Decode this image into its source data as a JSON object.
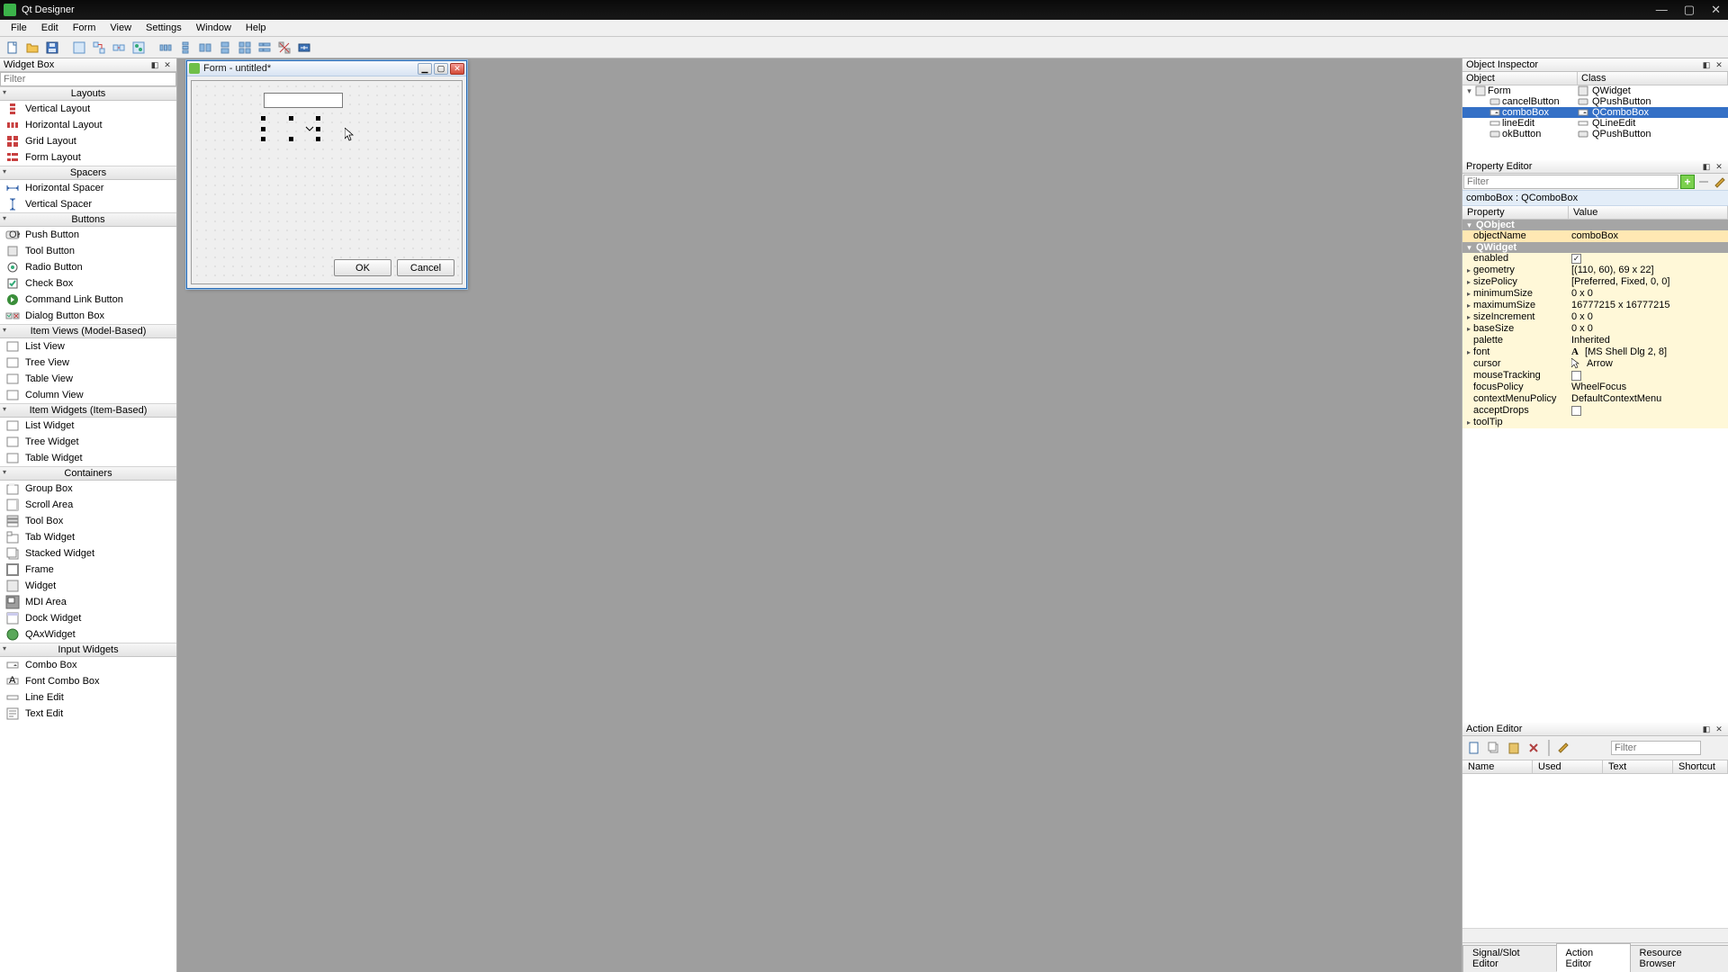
{
  "app": {
    "title": "Qt Designer"
  },
  "menu": [
    "File",
    "Edit",
    "Form",
    "View",
    "Settings",
    "Window",
    "Help"
  ],
  "widget_box": {
    "title": "Widget Box",
    "filter_ph": "Filter",
    "cats": [
      {
        "name": "Layouts",
        "items": [
          "Vertical Layout",
          "Horizontal Layout",
          "Grid Layout",
          "Form Layout"
        ]
      },
      {
        "name": "Spacers",
        "items": [
          "Horizontal Spacer",
          "Vertical Spacer"
        ]
      },
      {
        "name": "Buttons",
        "items": [
          "Push Button",
          "Tool Button",
          "Radio Button",
          "Check Box",
          "Command Link Button",
          "Dialog Button Box"
        ]
      },
      {
        "name": "Item Views (Model-Based)",
        "items": [
          "List View",
          "Tree View",
          "Table View",
          "Column View"
        ]
      },
      {
        "name": "Item Widgets (Item-Based)",
        "items": [
          "List Widget",
          "Tree Widget",
          "Table Widget"
        ]
      },
      {
        "name": "Containers",
        "items": [
          "Group Box",
          "Scroll Area",
          "Tool Box",
          "Tab Widget",
          "Stacked Widget",
          "Frame",
          "Widget",
          "MDI Area",
          "Dock Widget",
          "QAxWidget"
        ]
      },
      {
        "name": "Input Widgets",
        "items": [
          "Combo Box",
          "Font Combo Box",
          "Line Edit",
          "Text Edit"
        ]
      }
    ]
  },
  "form_window": {
    "title": "Form - untitled*",
    "ok": "OK",
    "cancel": "Cancel"
  },
  "object_inspector": {
    "title": "Object Inspector",
    "cols": [
      "Object",
      "Class"
    ],
    "rows": [
      {
        "name": "Form",
        "class": "QWidget",
        "depth": 0,
        "exp": true,
        "sel": false
      },
      {
        "name": "cancelButton",
        "class": "QPushButton",
        "depth": 1,
        "exp": false,
        "sel": false
      },
      {
        "name": "comboBox",
        "class": "QComboBox",
        "depth": 1,
        "exp": false,
        "sel": true
      },
      {
        "name": "lineEdit",
        "class": "QLineEdit",
        "depth": 1,
        "exp": false,
        "sel": false
      },
      {
        "name": "okButton",
        "class": "QPushButton",
        "depth": 1,
        "exp": false,
        "sel": false
      }
    ]
  },
  "property_editor": {
    "title": "Property Editor",
    "filter_ph": "Filter",
    "selection": "comboBox : QComboBox",
    "cols": [
      "Property",
      "Value"
    ],
    "groups": [
      {
        "name": "QObject",
        "rows": [
          {
            "p": "objectName",
            "v": "comboBox",
            "sel": true
          }
        ]
      },
      {
        "name": "QWidget",
        "rows": [
          {
            "p": "enabled",
            "v": "check",
            "y": true
          },
          {
            "p": "geometry",
            "v": "[(110, 60), 69 x 22]",
            "y": true,
            "exp": true
          },
          {
            "p": "sizePolicy",
            "v": "[Preferred, Fixed, 0, 0]",
            "y": true,
            "exp": true
          },
          {
            "p": "minimumSize",
            "v": "0 x 0",
            "y": true,
            "exp": true
          },
          {
            "p": "maximumSize",
            "v": "16777215 x 16777215",
            "y": true,
            "exp": true
          },
          {
            "p": "sizeIncrement",
            "v": "0 x 0",
            "y": true,
            "exp": true
          },
          {
            "p": "baseSize",
            "v": "0 x 0",
            "y": true,
            "exp": true
          },
          {
            "p": "palette",
            "v": "Inherited",
            "y": true
          },
          {
            "p": "font",
            "v": "[MS Shell Dlg 2, 8]",
            "y": true,
            "exp": true,
            "icon": "A"
          },
          {
            "p": "cursor",
            "v": "Arrow",
            "y": true,
            "icon": "arrow"
          },
          {
            "p": "mouseTracking",
            "v": "uncheck",
            "y": true
          },
          {
            "p": "focusPolicy",
            "v": "WheelFocus",
            "y": true
          },
          {
            "p": "contextMenuPolicy",
            "v": "DefaultContextMenu",
            "y": true
          },
          {
            "p": "acceptDrops",
            "v": "uncheck",
            "y": true
          },
          {
            "p": "toolTip",
            "v": "",
            "y": true,
            "exp": true
          }
        ]
      }
    ]
  },
  "action_editor": {
    "title": "Action Editor",
    "filter_ph": "Filter",
    "cols": [
      "Name",
      "Used",
      "Text",
      "Shortcut"
    ]
  },
  "tabs": [
    "Signal/Slot Editor",
    "Action Editor",
    "Resource Browser"
  ],
  "active_tab": 1
}
